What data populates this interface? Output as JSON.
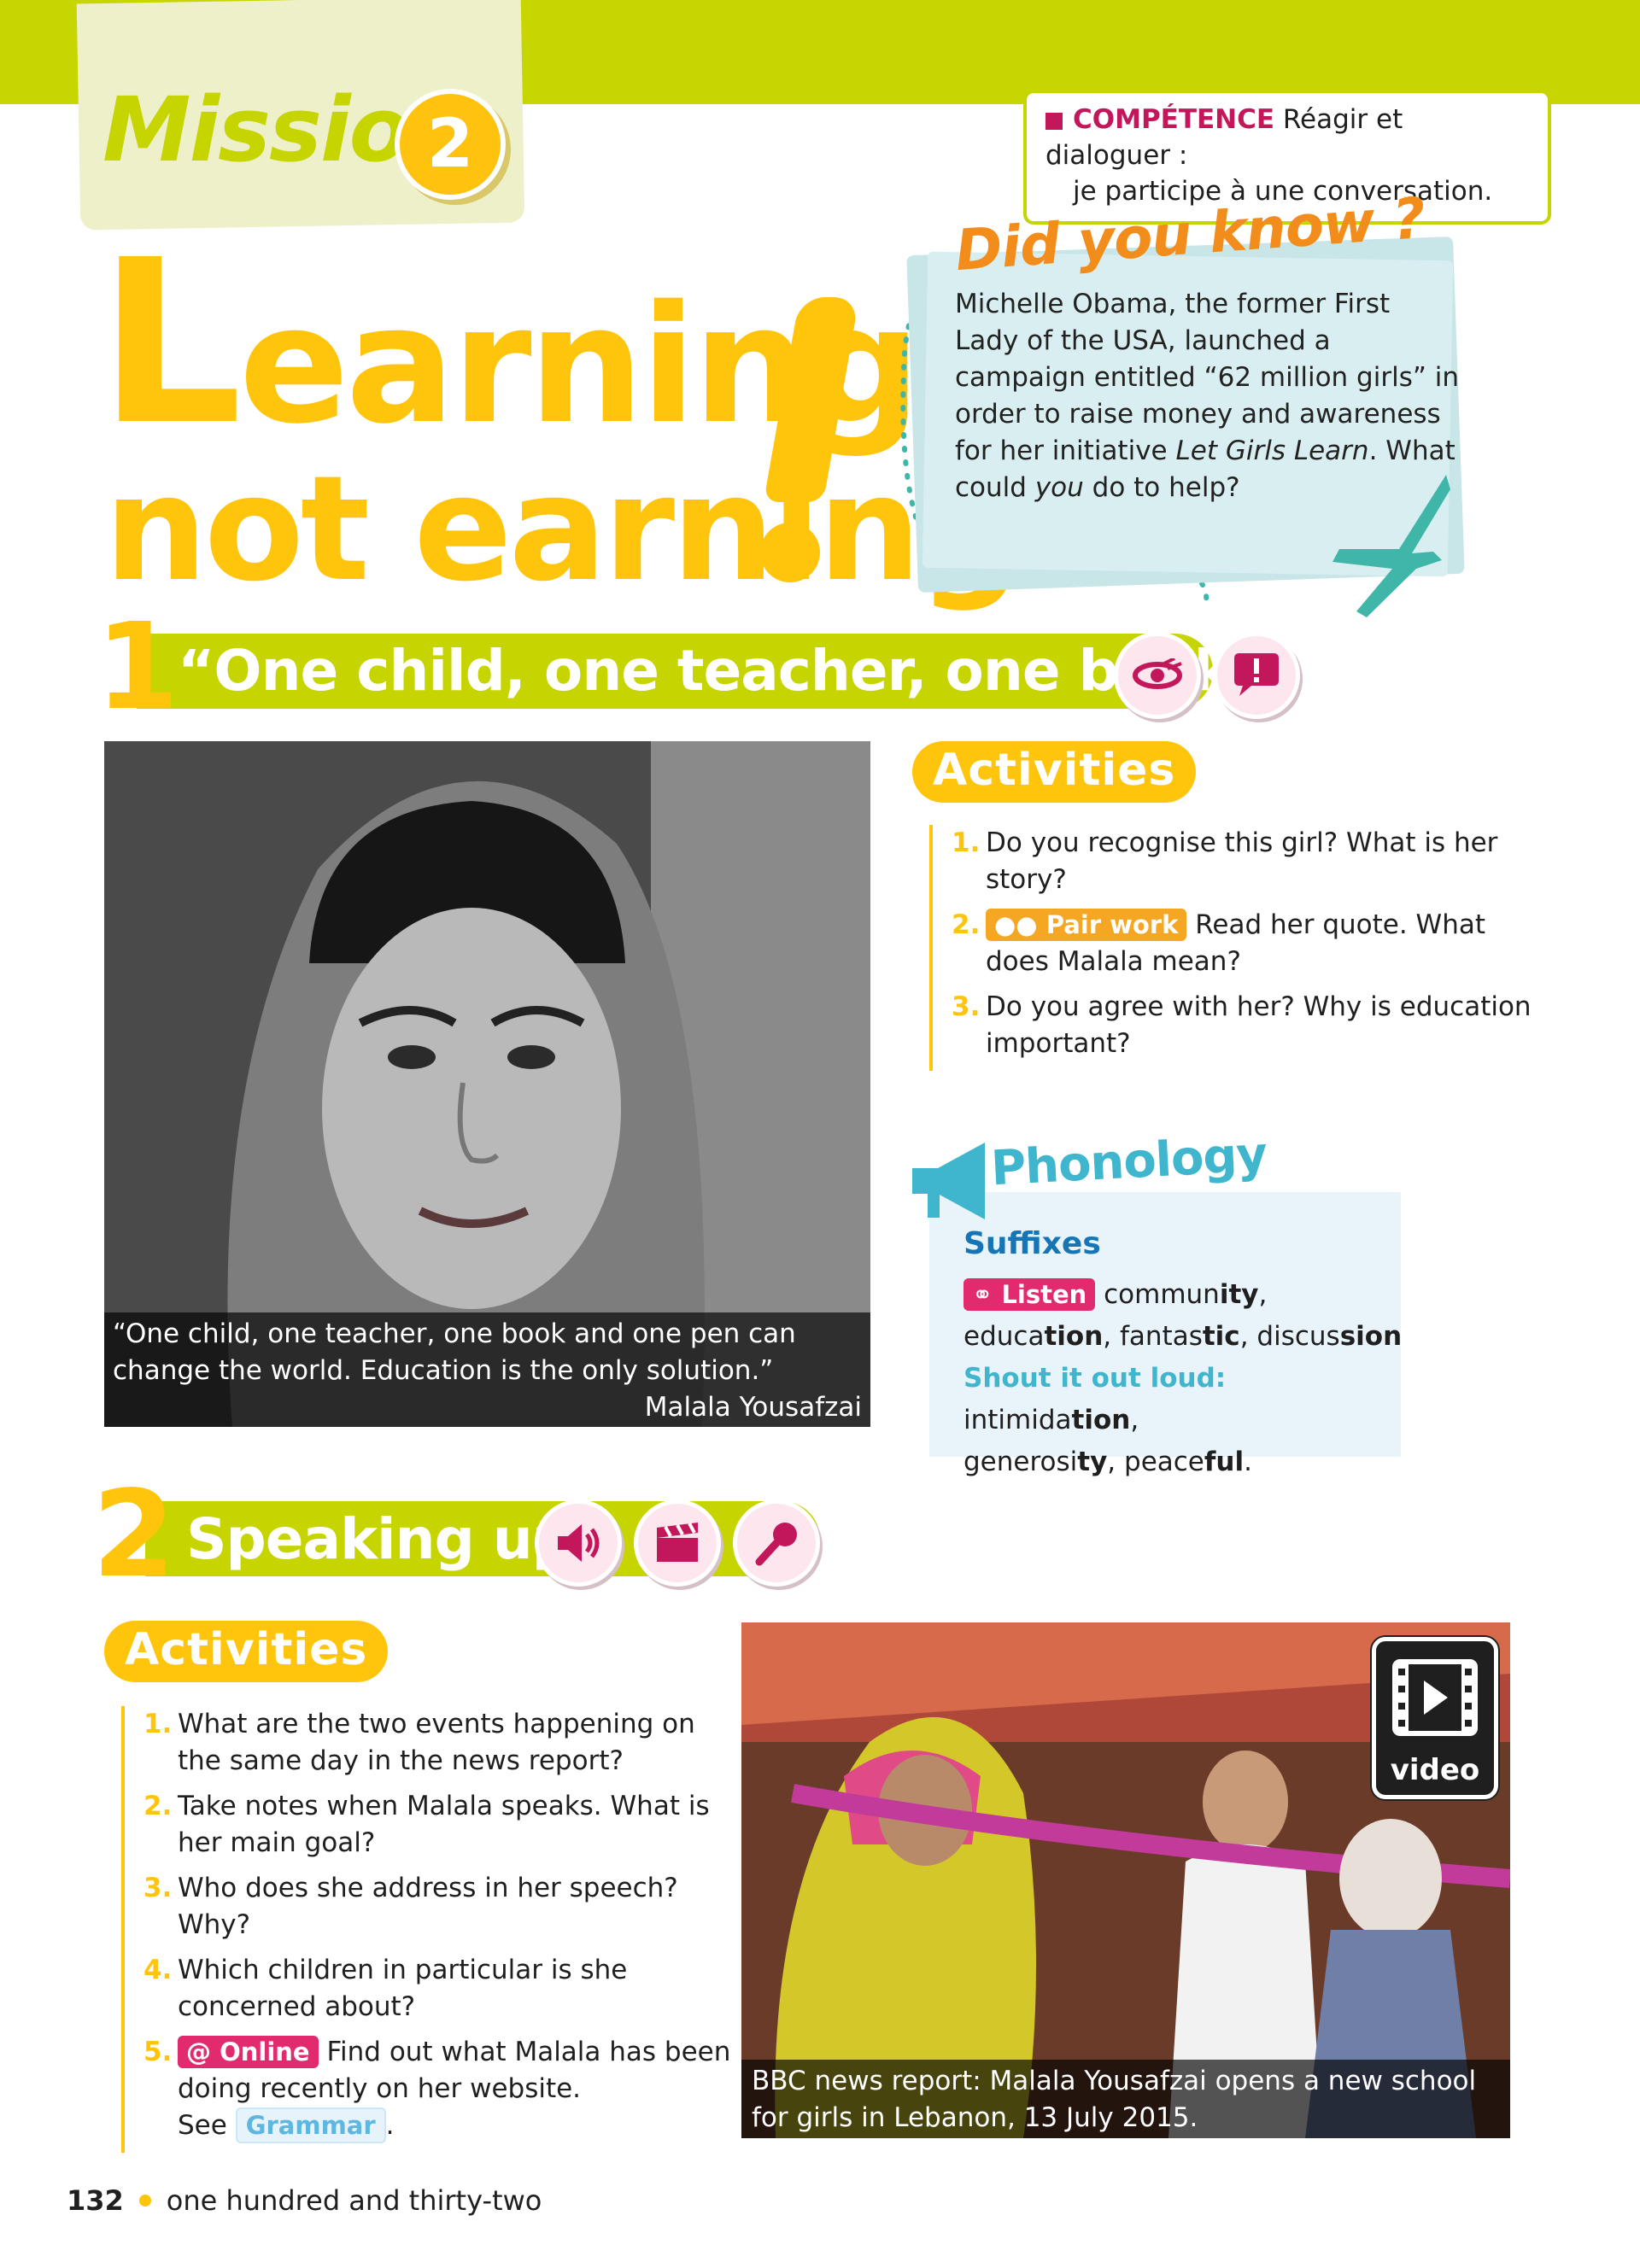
{
  "header": {
    "mission_word": "Mission",
    "mission_number": "2",
    "competence_label": "COMPÉTENCE",
    "competence_text_1": "Réagir et dialoguer :",
    "competence_text_2": "je participe à une conversation."
  },
  "title": {
    "line1_first": "L",
    "line1_rest": "earning",
    "line2": "not earning"
  },
  "did_you_know": {
    "title": "Did you know ?",
    "text_part1": "Michelle Obama, the former First Lady of the USA, launched a campaign entitled “62 million girls” in order to raise money and awareness for her initiative ",
    "text_italic1": "Let Girls Learn",
    "text_part2": ". What could ",
    "text_italic2": "you",
    "text_part3": " do to help?"
  },
  "section1": {
    "number": "1",
    "title": "“One child, one teacher, one book”",
    "icons": [
      "eye-icon",
      "speech-bubble-icon"
    ],
    "photo_caption_quote": "“One child, one teacher, one book and one pen can change the world. Education is the only solution.”",
    "photo_caption_author": "Malala Yousafzai",
    "activities_label": "Activities",
    "activities": [
      {
        "n": "1.",
        "text": "Do you recognise this girl? What is her story?"
      },
      {
        "n": "2.",
        "tag": "Pair work",
        "text": " Read her quote. What does Malala mean?"
      },
      {
        "n": "3.",
        "text": "Do you agree with her? Why is education important?"
      }
    ]
  },
  "phonology": {
    "title": "Phonology",
    "subtitle": "Suffixes",
    "listen_tag": "Listen",
    "listen_words": [
      {
        "base": "commun",
        "suffix": "ity",
        "sep": ","
      },
      {
        "base": "educa",
        "suffix": "tion",
        "sep": ","
      },
      {
        "base": "fantas",
        "suffix": "tic",
        "sep": ","
      },
      {
        "base": "discus",
        "suffix": "sion",
        "sep": ""
      }
    ],
    "shout_label": "Shout it out loud:",
    "shout_words": [
      {
        "base": "intimida",
        "suffix": "tion",
        "sep": ","
      },
      {
        "base": "generosi",
        "suffix": "ty",
        "sep": ","
      },
      {
        "base": "peace",
        "suffix": "ful",
        "sep": "."
      }
    ]
  },
  "section2": {
    "number": "2",
    "title": "Speaking up!",
    "icons": [
      "speaker-icon",
      "clapperboard-icon",
      "microphone-icon"
    ],
    "activities_label": "Activities",
    "activities": [
      {
        "n": "1.",
        "text": "What are the two events happening on the same day in the news report?"
      },
      {
        "n": "2.",
        "text": "Take notes when Malala speaks. What is her main goal?"
      },
      {
        "n": "3.",
        "text": "Who does she address in her speech? Why?"
      },
      {
        "n": "4.",
        "text": "Which children in particular is she concerned about?"
      },
      {
        "n": "5.",
        "tag": "@ Online",
        "text": " Find out what Malala has been doing recently on her website.",
        "see": "See",
        "grammar": "Grammar",
        "end": "."
      }
    ],
    "video_label": "video",
    "photo_caption": "BBC news report: Malala Yousafzai opens a new school for girls in Lebanon, 13 July 2015."
  },
  "footer": {
    "page_number": "132",
    "page_words": "one hundred and thirty-two"
  }
}
